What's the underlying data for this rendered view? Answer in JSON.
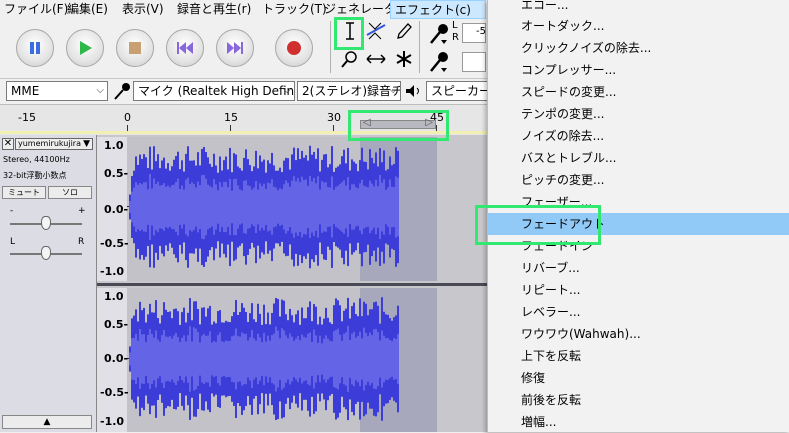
{
  "menubar": {
    "items": [
      "ファイル(F)",
      "編集(E)",
      "表示(V)",
      "録音と再生(r)",
      "トラック(T)",
      "ジェネレーター(G)",
      "エフェクト(c)"
    ]
  },
  "device": {
    "host": "MME",
    "input": "マイク (Realtek High Defini",
    "channels": "2(ステレオ)録音チ",
    "output": "スピーカー /"
  },
  "meter": {
    "left": "L",
    "right": "R",
    "value": "-5"
  },
  "ruler": {
    "ticks": [
      "-15",
      "0",
      "15",
      "30",
      "45"
    ]
  },
  "track": {
    "name": "yumemirukujira",
    "format": "Stereo, 44100Hz",
    "bits": "32-bit浮動小数点",
    "mute": "ミュート",
    "solo": "ソロ",
    "gain_minus": "-",
    "gain_plus": "+",
    "pan_left": "L",
    "pan_right": "R"
  },
  "scale": [
    "1.0",
    "0.5-",
    "0.0-",
    "-0.5-",
    "-1.0"
  ],
  "effects_menu": {
    "items": [
      "エコー...",
      "オートダック...",
      "クリックノイズの除去...",
      "コンプレッサー...",
      "スピードの変更...",
      "テンポの変更...",
      "ノイズの除去...",
      "バスとトレブル...",
      "ピッチの変更...",
      "フェーザー...",
      "フェードアウト",
      "フェードイン",
      "リバーブ...",
      "リピート...",
      "レベラー...",
      "ワウワウ(Wahwah)...",
      "上下を反転",
      "修復",
      "前後を反転",
      "増幅..."
    ],
    "highlighted": "フェードアウト"
  },
  "colors": {
    "waveform": "#3c3cd8",
    "waveform_rms": "#6464e6",
    "selection": "#a8a8bc",
    "highlight": "#91c9f7",
    "annotation": "#33e870"
  }
}
